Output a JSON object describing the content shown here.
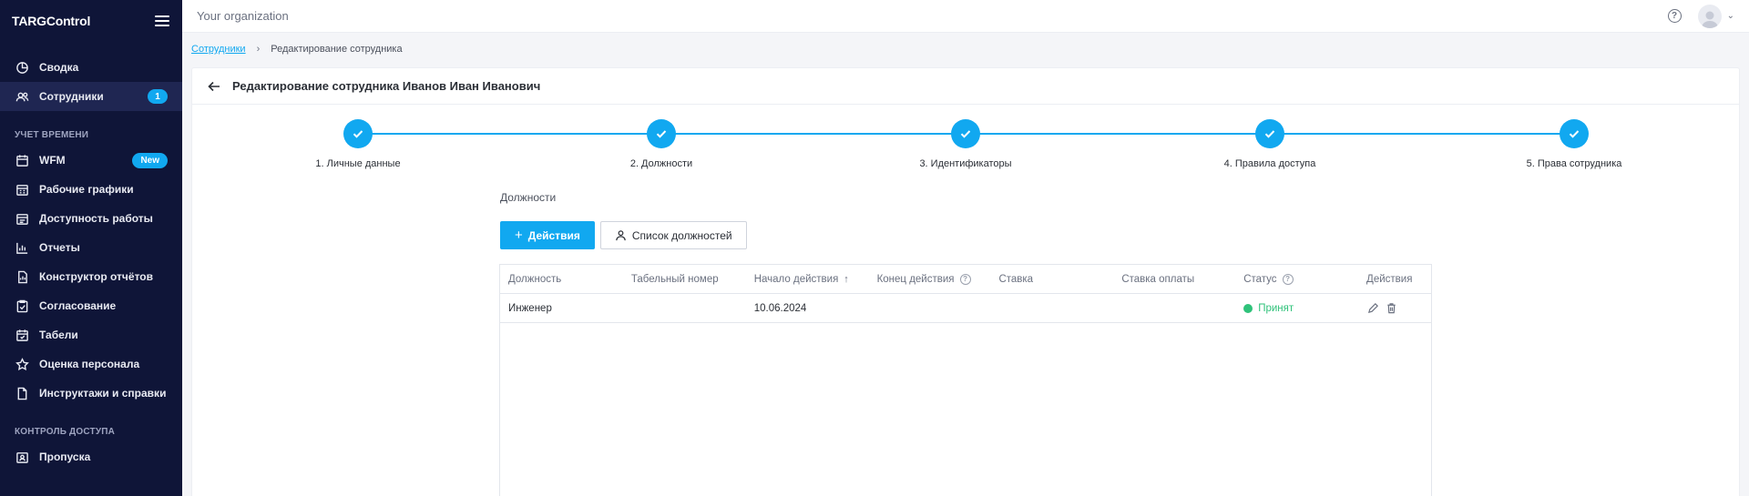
{
  "app": {
    "logo": "TARGControl",
    "organization": "Your organization"
  },
  "sidebar": {
    "items_top": [
      {
        "label": "Сводка",
        "icon": "chart-pie-icon"
      },
      {
        "label": "Сотрудники",
        "icon": "users-icon",
        "badge": "1",
        "active": true
      }
    ],
    "section_time": "УЧЕТ ВРЕМЕНИ",
    "items_time": [
      {
        "label": "WFM",
        "icon": "calendar-icon",
        "badge_new": "New"
      },
      {
        "label": "Рабочие графики",
        "icon": "schedule-icon"
      },
      {
        "label": "Доступность работы",
        "icon": "availability-icon"
      },
      {
        "label": "Отчеты",
        "icon": "bar-chart-icon"
      },
      {
        "label": "Конструктор отчётов",
        "icon": "report-builder-icon"
      },
      {
        "label": "Согласование",
        "icon": "approval-icon"
      },
      {
        "label": "Табели",
        "icon": "timesheet-icon"
      },
      {
        "label": "Оценка персонала",
        "icon": "star-icon"
      },
      {
        "label": "Инструктажи и справки",
        "icon": "document-icon"
      }
    ],
    "section_access": "КОНТРОЛЬ ДОСТУПА",
    "items_access": [
      {
        "label": "Пропуска",
        "icon": "badge-icon"
      }
    ]
  },
  "breadcrumb": {
    "link": "Сотрудники",
    "current": "Редактирование сотрудника"
  },
  "page": {
    "title": "Редактирование сотрудника Иванов Иван Иванович"
  },
  "stepper": {
    "steps": [
      "1. Личные данные",
      "2. Должности",
      "3. Идентификаторы",
      "4. Правила доступа",
      "5. Права сотрудника"
    ],
    "completed": 5
  },
  "positions": {
    "section_title": "Должности",
    "btn_actions": "Действия",
    "btn_list": "Список должностей",
    "columns": [
      "Должность",
      "Табельный номер",
      "Начало действия",
      "Конец действия",
      "Ставка",
      "Ставка оплаты",
      "Статус",
      "Действия"
    ],
    "rows": [
      {
        "position": "Инженер",
        "tab_number": "",
        "start": "10.06.2024",
        "end": "",
        "rate": "",
        "pay_rate": "",
        "status": "Принят"
      }
    ]
  },
  "colors": {
    "accent": "#11a8f0",
    "sidebar_bg": "#0f1538",
    "status_ok": "#2fc27a"
  }
}
